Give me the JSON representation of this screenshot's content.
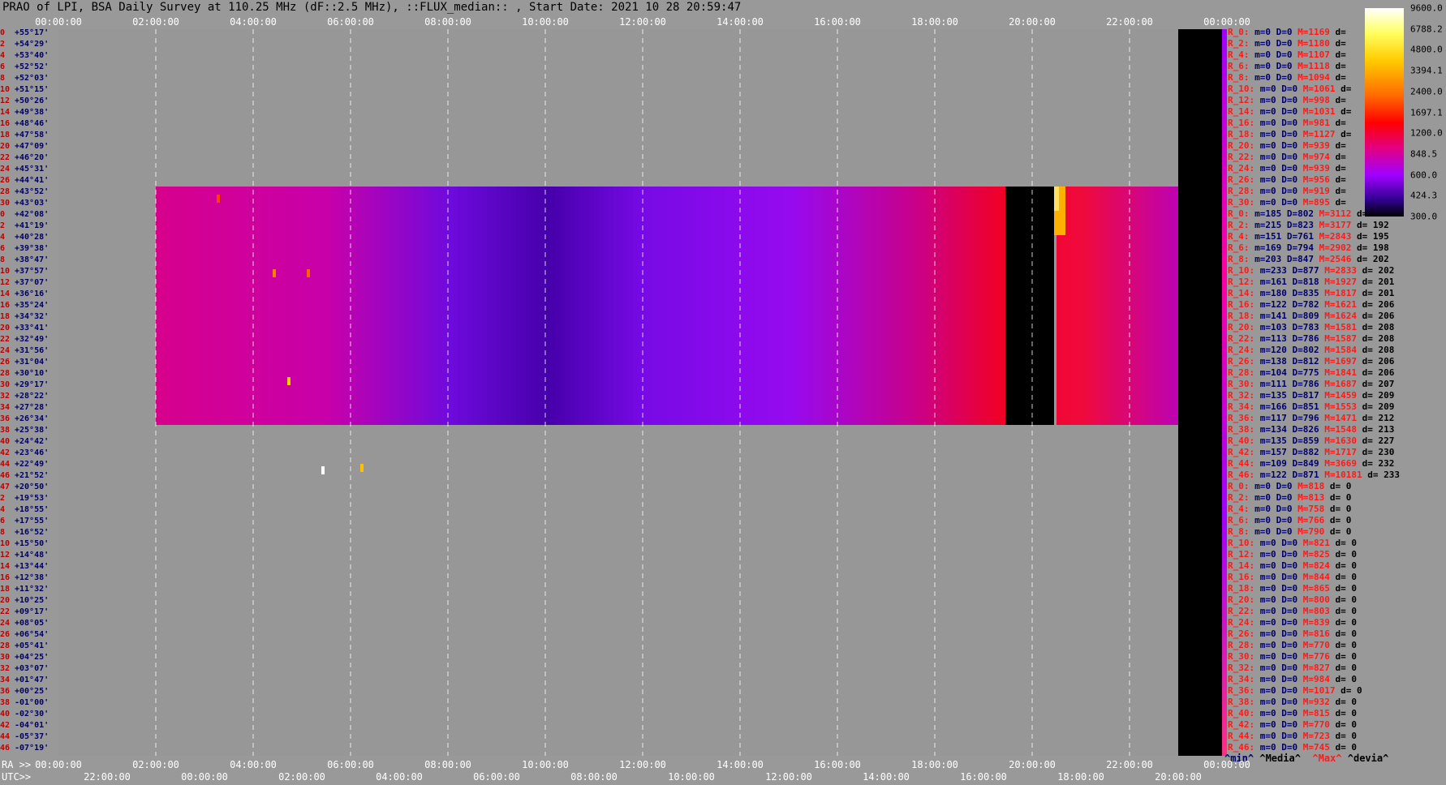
{
  "title": "PRAO of LPI, BSA Daily Survey at 110.25 MHz (dF::2.5 MHz), ::FLUX_median:: , Start Date: 2021 10 28 20:59:47",
  "top_ticks": [
    "00:00:00",
    "02:00:00",
    "04:00:00",
    "06:00:00",
    "08:00:00",
    "10:00:00",
    "12:00:00",
    "14:00:00",
    "16:00:00",
    "18:00:00",
    "20:00:00",
    "22:00:00",
    "00:00:00"
  ],
  "ra_label": "RA >>",
  "utc_label": "UTC>>",
  "ra_ticks": [
    "00:00:00",
    "02:00:00",
    "04:00:00",
    "06:00:00",
    "08:00:00",
    "10:00:00",
    "12:00:00",
    "14:00:00",
    "16:00:00",
    "18:00:00",
    "20:00:00",
    "22:00:00",
    "00:00:00"
  ],
  "utc_ticks": [
    "22:00:00",
    "00:00:00",
    "02:00:00",
    "04:00:00",
    "06:00:00",
    "08:00:00",
    "10:00:00",
    "12:00:00",
    "14:00:00",
    "16:00:00",
    "18:00:00",
    "20:00:00"
  ],
  "legend": {
    "min": "^min^",
    "median": "^Media^",
    "max": "^Max^",
    "dev": "^devia^"
  },
  "colorbar": {
    "ticks": [
      "9600.0",
      "6788.2",
      "4800.0",
      "3394.1",
      "2400.0",
      "1697.1",
      "1200.0",
      "848.5",
      "600.0",
      "424.3",
      "300.0"
    ],
    "colors": [
      "#ffffff",
      "#ffff60",
      "#ffcc00",
      "#ff6a00",
      "#ff0000",
      "#e0008a",
      "#a000ff",
      "#300090",
      "#000000"
    ]
  },
  "rows": [
    {
      "i": "0",
      "dec": "+55°17'"
    },
    {
      "i": "2",
      "dec": "+54°29'"
    },
    {
      "i": "4",
      "dec": "+53°40'"
    },
    {
      "i": "6",
      "dec": "+52°52'"
    },
    {
      "i": "8",
      "dec": "+52°03'"
    },
    {
      "i": "10",
      "dec": "+51°15'"
    },
    {
      "i": "12",
      "dec": "+50°26'"
    },
    {
      "i": "14",
      "dec": "+49°38'"
    },
    {
      "i": "16",
      "dec": "+48°46'"
    },
    {
      "i": "18",
      "dec": "+47°58'"
    },
    {
      "i": "20",
      "dec": "+47°09'"
    },
    {
      "i": "22",
      "dec": "+46°20'"
    },
    {
      "i": "24",
      "dec": "+45°31'"
    },
    {
      "i": "26",
      "dec": "+44°41'"
    },
    {
      "i": "28",
      "dec": "+43°52'"
    },
    {
      "i": "30",
      "dec": "+43°03'"
    },
    {
      "i": "0",
      "dec": "+42°08'"
    },
    {
      "i": "2",
      "dec": "+41°19'"
    },
    {
      "i": "4",
      "dec": "+40°28'"
    },
    {
      "i": "6",
      "dec": "+39°38'"
    },
    {
      "i": "8",
      "dec": "+38°47'"
    },
    {
      "i": "10",
      "dec": "+37°57'"
    },
    {
      "i": "12",
      "dec": "+37°07'"
    },
    {
      "i": "14",
      "dec": "+36°16'"
    },
    {
      "i": "16",
      "dec": "+35°24'"
    },
    {
      "i": "18",
      "dec": "+34°32'"
    },
    {
      "i": "20",
      "dec": "+33°41'"
    },
    {
      "i": "22",
      "dec": "+32°49'"
    },
    {
      "i": "24",
      "dec": "+31°56'"
    },
    {
      "i": "26",
      "dec": "+31°04'"
    },
    {
      "i": "28",
      "dec": "+30°10'"
    },
    {
      "i": "30",
      "dec": "+29°17'"
    },
    {
      "i": "32",
      "dec": "+28°22'"
    },
    {
      "i": "34",
      "dec": "+27°28'"
    },
    {
      "i": "36",
      "dec": "+26°34'"
    },
    {
      "i": "38",
      "dec": "+25°38'"
    },
    {
      "i": "40",
      "dec": "+24°42'"
    },
    {
      "i": "42",
      "dec": "+23°46'"
    },
    {
      "i": "44",
      "dec": "+22°49'"
    },
    {
      "i": "46",
      "dec": "+21°52'"
    },
    {
      "i": "47",
      "dec": "+20°50'"
    },
    {
      "i": "2",
      "dec": "+19°53'"
    },
    {
      "i": "4",
      "dec": "+18°55'"
    },
    {
      "i": "6",
      "dec": "+17°55'"
    },
    {
      "i": "8",
      "dec": "+16°52'"
    },
    {
      "i": "10",
      "dec": "+15°50'"
    },
    {
      "i": "12",
      "dec": "+14°48'"
    },
    {
      "i": "14",
      "dec": "+13°44'"
    },
    {
      "i": "16",
      "dec": "+12°38'"
    },
    {
      "i": "18",
      "dec": "+11°32'"
    },
    {
      "i": "20",
      "dec": "+10°25'"
    },
    {
      "i": "22",
      "dec": "+09°17'"
    },
    {
      "i": "24",
      "dec": "+08°05'"
    },
    {
      "i": "26",
      "dec": "+06°54'"
    },
    {
      "i": "28",
      "dec": "+05°41'"
    },
    {
      "i": "30",
      "dec": "+04°25'"
    },
    {
      "i": "32",
      "dec": "+03°07'"
    },
    {
      "i": "34",
      "dec": "+01°47'"
    },
    {
      "i": "36",
      "dec": "+00°25'"
    },
    {
      "i": "38",
      "dec": "-01°00'"
    },
    {
      "i": "40",
      "dec": "-02°30'"
    },
    {
      "i": "42",
      "dec": "-04°01'"
    },
    {
      "i": "44",
      "dec": "-05°37'"
    },
    {
      "i": "46",
      "dec": "-07°19'"
    }
  ],
  "stats": [
    {
      "n": "R_0:",
      "m": "m=0",
      "d": "D=0",
      "M": "M=1169",
      "dv": "d="
    },
    {
      "n": "R_2:",
      "m": "m=0",
      "d": "D=0",
      "M": "M=1180",
      "dv": "d="
    },
    {
      "n": "R_4:",
      "m": "m=0",
      "d": "D=0",
      "M": "M=1107",
      "dv": "d="
    },
    {
      "n": "R_6:",
      "m": "m=0",
      "d": "D=0",
      "M": "M=1118",
      "dv": "d="
    },
    {
      "n": "R_8:",
      "m": "m=0",
      "d": "D=0",
      "M": "M=1094",
      "dv": "d="
    },
    {
      "n": "R_10:",
      "m": "m=0",
      "d": "D=0",
      "M": "M=1061",
      "dv": "d="
    },
    {
      "n": "R_12:",
      "m": "m=0",
      "d": "D=0",
      "M": "M=998",
      "dv": "d="
    },
    {
      "n": "R_14:",
      "m": "m=0",
      "d": "D=0",
      "M": "M=1031",
      "dv": "d="
    },
    {
      "n": "R_16:",
      "m": "m=0",
      "d": "D=0",
      "M": "M=981",
      "dv": "d="
    },
    {
      "n": "R_18:",
      "m": "m=0",
      "d": "D=0",
      "M": "M=1127",
      "dv": "d="
    },
    {
      "n": "R_20:",
      "m": "m=0",
      "d": "D=0",
      "M": "M=939",
      "dv": "d="
    },
    {
      "n": "R_22:",
      "m": "m=0",
      "d": "D=0",
      "M": "M=974",
      "dv": "d="
    },
    {
      "n": "R_24:",
      "m": "m=0",
      "d": "D=0",
      "M": "M=939",
      "dv": "d="
    },
    {
      "n": "R_26:",
      "m": "m=0",
      "d": "D=0",
      "M": "M=956",
      "dv": "d="
    },
    {
      "n": "R_28:",
      "m": "m=0",
      "d": "D=0",
      "M": "M=919",
      "dv": "d="
    },
    {
      "n": "R_30:",
      "m": "m=0",
      "d": "D=0",
      "M": "M=895",
      "dv": "d="
    },
    {
      "n": "R_0:",
      "m": "m=185",
      "d": "D=802",
      "M": "M=3112",
      "dv": "d="
    },
    {
      "n": "R_2:",
      "m": "m=215",
      "d": "D=823",
      "M": "M=3177",
      "dv": "d= 192"
    },
    {
      "n": "R_4:",
      "m": "m=151",
      "d": "D=761",
      "M": "M=2843",
      "dv": "d= 195"
    },
    {
      "n": "R_6:",
      "m": "m=169",
      "d": "D=794",
      "M": "M=2902",
      "dv": "d= 198"
    },
    {
      "n": "R_8:",
      "m": "m=203",
      "d": "D=847",
      "M": "M=2546",
      "dv": "d= 202"
    },
    {
      "n": "R_10:",
      "m": "m=233",
      "d": "D=877",
      "M": "M=2833",
      "dv": "d= 202"
    },
    {
      "n": "R_12:",
      "m": "m=161",
      "d": "D=818",
      "M": "M=1927",
      "dv": "d= 201"
    },
    {
      "n": "R_14:",
      "m": "m=180",
      "d": "D=835",
      "M": "M=1817",
      "dv": "d= 201"
    },
    {
      "n": "R_16:",
      "m": "m=122",
      "d": "D=782",
      "M": "M=1621",
      "dv": "d= 206"
    },
    {
      "n": "R_18:",
      "m": "m=141",
      "d": "D=809",
      "M": "M=1624",
      "dv": "d= 206"
    },
    {
      "n": "R_20:",
      "m": "m=103",
      "d": "D=783",
      "M": "M=1581",
      "dv": "d= 208"
    },
    {
      "n": "R_22:",
      "m": "m=113",
      "d": "D=786",
      "M": "M=1587",
      "dv": "d= 208"
    },
    {
      "n": "R_24:",
      "m": "m=120",
      "d": "D=802",
      "M": "M=1584",
      "dv": "d= 208"
    },
    {
      "n": "R_26:",
      "m": "m=138",
      "d": "D=812",
      "M": "M=1697",
      "dv": "d= 206"
    },
    {
      "n": "R_28:",
      "m": "m=104",
      "d": "D=775",
      "M": "M=1841",
      "dv": "d= 206"
    },
    {
      "n": "R_30:",
      "m": "m=111",
      "d": "D=786",
      "M": "M=1687",
      "dv": "d= 207"
    },
    {
      "n": "R_32:",
      "m": "m=135",
      "d": "D=817",
      "M": "M=1459",
      "dv": "d= 209"
    },
    {
      "n": "R_34:",
      "m": "m=166",
      "d": "D=851",
      "M": "M=1553",
      "dv": "d= 209"
    },
    {
      "n": "R_36:",
      "m": "m=117",
      "d": "D=796",
      "M": "M=1471",
      "dv": "d= 212"
    },
    {
      "n": "R_38:",
      "m": "m=134",
      "d": "D=826",
      "M": "M=1548",
      "dv": "d= 213"
    },
    {
      "n": "R_40:",
      "m": "m=135",
      "d": "D=859",
      "M": "M=1630",
      "dv": "d= 227"
    },
    {
      "n": "R_42:",
      "m": "m=157",
      "d": "D=882",
      "M": "M=1717",
      "dv": "d= 230"
    },
    {
      "n": "R_44:",
      "m": "m=109",
      "d": "D=849",
      "M": "M=3669",
      "dv": "d= 232"
    },
    {
      "n": "R_46:",
      "m": "m=122",
      "d": "D=871",
      "M": "M=10181",
      "dv": "d= 233"
    },
    {
      "n": "R_0:",
      "m": "m=0",
      "d": "D=0",
      "M": "M=818",
      "dv": "d= 0"
    },
    {
      "n": "R_2:",
      "m": "m=0",
      "d": "D=0",
      "M": "M=813",
      "dv": "d= 0"
    },
    {
      "n": "R_4:",
      "m": "m=0",
      "d": "D=0",
      "M": "M=758",
      "dv": "d= 0"
    },
    {
      "n": "R_6:",
      "m": "m=0",
      "d": "D=0",
      "M": "M=766",
      "dv": "d= 0"
    },
    {
      "n": "R_8:",
      "m": "m=0",
      "d": "D=0",
      "M": "M=790",
      "dv": "d= 0"
    },
    {
      "n": "R_10:",
      "m": "m=0",
      "d": "D=0",
      "M": "M=821",
      "dv": "d= 0"
    },
    {
      "n": "R_12:",
      "m": "m=0",
      "d": "D=0",
      "M": "M=825",
      "dv": "d= 0"
    },
    {
      "n": "R_14:",
      "m": "m=0",
      "d": "D=0",
      "M": "M=824",
      "dv": "d= 0"
    },
    {
      "n": "R_16:",
      "m": "m=0",
      "d": "D=0",
      "M": "M=844",
      "dv": "d= 0"
    },
    {
      "n": "R_18:",
      "m": "m=0",
      "d": "D=0",
      "M": "M=865",
      "dv": "d= 0"
    },
    {
      "n": "R_20:",
      "m": "m=0",
      "d": "D=0",
      "M": "M=800",
      "dv": "d= 0"
    },
    {
      "n": "R_22:",
      "m": "m=0",
      "d": "D=0",
      "M": "M=803",
      "dv": "d= 0"
    },
    {
      "n": "R_24:",
      "m": "m=0",
      "d": "D=0",
      "M": "M=839",
      "dv": "d= 0"
    },
    {
      "n": "R_26:",
      "m": "m=0",
      "d": "D=0",
      "M": "M=816",
      "dv": "d= 0"
    },
    {
      "n": "R_28:",
      "m": "m=0",
      "d": "D=0",
      "M": "M=770",
      "dv": "d= 0"
    },
    {
      "n": "R_30:",
      "m": "m=0",
      "d": "D=0",
      "M": "M=776",
      "dv": "d= 0"
    },
    {
      "n": "R_32:",
      "m": "m=0",
      "d": "D=0",
      "M": "M=827",
      "dv": "d= 0"
    },
    {
      "n": "R_34:",
      "m": "m=0",
      "d": "D=0",
      "M": "M=984",
      "dv": "d= 0"
    },
    {
      "n": "R_36:",
      "m": "m=0",
      "d": "D=0",
      "M": "M=1017",
      "dv": "d= 0"
    },
    {
      "n": "R_38:",
      "m": "m=0",
      "d": "D=0",
      "M": "M=932",
      "dv": "d= 0"
    },
    {
      "n": "R_40:",
      "m": "m=0",
      "d": "D=0",
      "M": "M=815",
      "dv": "d= 0"
    },
    {
      "n": "R_42:",
      "m": "m=0",
      "d": "D=0",
      "M": "M=770",
      "dv": "d= 0"
    },
    {
      "n": "R_44:",
      "m": "m=0",
      "d": "D=0",
      "M": "M=723",
      "dv": "d= 0"
    },
    {
      "n": "R_46:",
      "m": "m=0",
      "d": "D=0",
      "M": "M=745",
      "dv": "d= 0"
    }
  ],
  "chart_data": {
    "type": "heatmap",
    "title": "PRAO of LPI, BSA Daily Survey at 110.25 MHz (dF::2.5 MHz), ::FLUX_median:: , Start Date: 2021 10 28 20:59:47",
    "x_axis_top": "RA",
    "x_axis_bottom": [
      "RA",
      "UTC"
    ],
    "y_axis": "Declination",
    "color_scale": "log",
    "color_range": [
      300.0,
      9600.0
    ],
    "active_band_rows": "R_0 .. R_46 (+42°08' to +20°50')",
    "notes_visible": "Active data band between RA 02:00 and 23:50; black gap near RA 19:30-20:10"
  }
}
